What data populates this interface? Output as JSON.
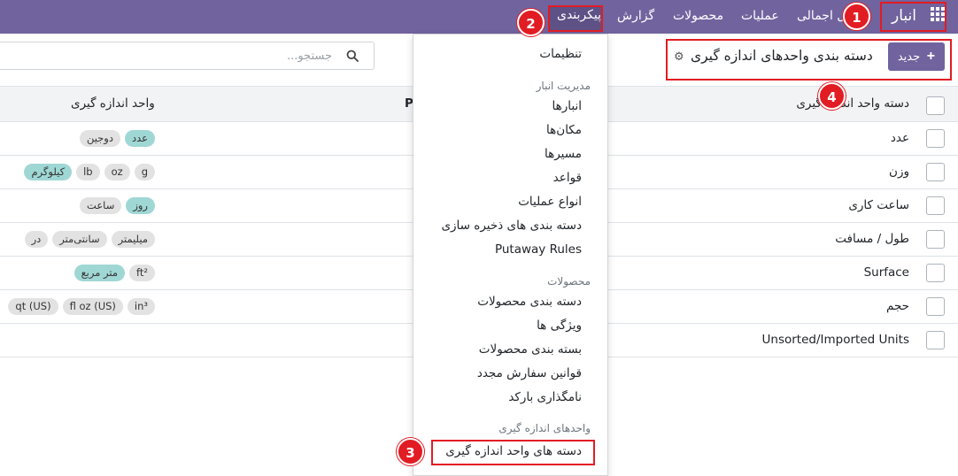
{
  "navbar": {
    "brand": "انبار",
    "menu": {
      "overview": "ل اجمالی",
      "operations": "عملیات",
      "products": "محصولات",
      "reports": "گزارش",
      "configuration": "پیکربندی"
    }
  },
  "control_panel": {
    "title": "دسته بندی واحدهای اندازه گیری",
    "new_button": "جدید",
    "search_placeholder": "جستجو..."
  },
  "table": {
    "headers": {
      "category": "دسته واحد اندازه گیری",
      "p": "P",
      "uom": "واحد اندازه گیری"
    },
    "rows": [
      {
        "category": "عدد",
        "tags": [
          {
            "label": "عدد",
            "reference": true
          },
          {
            "label": "دوجین",
            "reference": false
          }
        ]
      },
      {
        "category": "وزن",
        "tags": [
          {
            "label": "g",
            "reference": false
          },
          {
            "label": "oz",
            "reference": false
          },
          {
            "label": "lb",
            "reference": false
          },
          {
            "label": "کیلوگرم",
            "reference": true
          }
        ]
      },
      {
        "category": "ساعت کاری",
        "tags": [
          {
            "label": "روز",
            "reference": true
          },
          {
            "label": "ساعت",
            "reference": false
          }
        ]
      },
      {
        "category": "طول / مسافت",
        "tags": [
          {
            "label": "میلیمتر",
            "reference": false
          },
          {
            "label": "سانتی‌متر",
            "reference": false
          },
          {
            "label": "در",
            "reference": false
          }
        ]
      },
      {
        "category": "Surface",
        "tags": [
          {
            "label": "ft²",
            "reference": false
          },
          {
            "label": "متر مربع",
            "reference": true
          }
        ]
      },
      {
        "category": "حجم",
        "tags": [
          {
            "label": "in³",
            "reference": false
          },
          {
            "label": "fl oz (US)",
            "reference": false
          },
          {
            "label": "qt (US)",
            "reference": false
          }
        ]
      },
      {
        "category": "Unsorted/Imported Units",
        "tags": []
      }
    ]
  },
  "dropdown": {
    "settings": "تنظیمات",
    "warehouse_header": "مدیریت انبار",
    "warehouse_items": [
      "انبارها",
      "مکان‌ها",
      "مسیرها",
      "قواعد",
      "انواع عملیات",
      "دسته بندی های ذخیره سازی",
      "Putaway Rules"
    ],
    "products_header": "محصولات",
    "products_items": [
      "دسته بندی محصولات",
      "ویژگی ها",
      "بسته بندی محصولات",
      "قوانین سفارش مجدد",
      "نامگذاری بارکد"
    ],
    "uom_header": "واحدهای اندازه گیری",
    "uom_items": [
      "دسته های واحد اندازه گیری"
    ]
  },
  "annotations": {
    "step1": "1",
    "step2": "2",
    "step3": "3",
    "step4": "4",
    "highlight_color": "#e21c23"
  },
  "colors": {
    "navbar": "#71639e",
    "primary_button": "#71639e",
    "reference_tag": "#9fd7d4"
  }
}
